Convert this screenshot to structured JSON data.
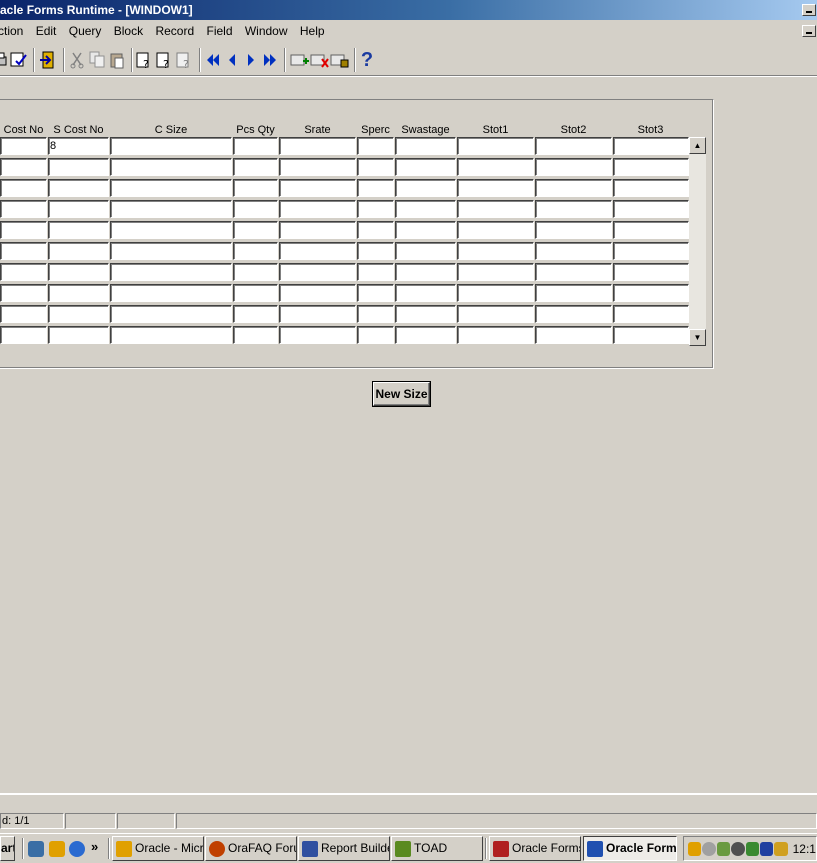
{
  "window": {
    "title": "acle Forms Runtime - [WINDOW1]"
  },
  "menu": [
    "ction",
    "Edit",
    "Query",
    "Block",
    "Record",
    "Field",
    "Window",
    "Help"
  ],
  "toolbar": {
    "help_glyph": "?",
    "icons": [
      "print-icon",
      "save-icon",
      "exit-icon",
      "cut-icon",
      "copy-icon",
      "paste-icon",
      "enter-query-icon",
      "execute-query-icon",
      "cancel-query-icon",
      "first-record-icon",
      "previous-record-icon",
      "next-record-icon",
      "last-record-icon",
      "insert-record-icon",
      "delete-record-icon",
      "lock-record-icon",
      "help-icon"
    ]
  },
  "grid": {
    "columns": [
      "Cost No",
      "S Cost No",
      "C Size",
      "Pcs Qty",
      "Srate",
      "Sperc",
      "Swastage",
      "Stot1",
      "Stot2",
      "Stot3"
    ],
    "rows": [
      [
        "",
        "8",
        "",
        "",
        "",
        "",
        "",
        "",
        "",
        ""
      ],
      [
        "",
        "",
        "",
        "",
        "",
        "",
        "",
        "",
        "",
        ""
      ],
      [
        "",
        "",
        "",
        "",
        "",
        "",
        "",
        "",
        "",
        ""
      ],
      [
        "",
        "",
        "",
        "",
        "",
        "",
        "",
        "",
        "",
        ""
      ],
      [
        "",
        "",
        "",
        "",
        "",
        "",
        "",
        "",
        "",
        ""
      ],
      [
        "",
        "",
        "",
        "",
        "",
        "",
        "",
        "",
        "",
        ""
      ],
      [
        "",
        "",
        "",
        "",
        "",
        "",
        "",
        "",
        "",
        ""
      ],
      [
        "",
        "",
        "",
        "",
        "",
        "",
        "",
        "",
        "",
        ""
      ],
      [
        "",
        "",
        "",
        "",
        "",
        "",
        "",
        "",
        "",
        ""
      ],
      [
        "",
        "",
        "",
        "",
        "",
        "",
        "",
        "",
        "",
        ""
      ]
    ],
    "scroll_up": "▲",
    "scroll_down": "▼"
  },
  "buttons": {
    "new_size": "New Size"
  },
  "status": {
    "record": "d: 1/1"
  },
  "taskbar": {
    "start": "art",
    "more": "»",
    "tasks": [
      {
        "label": "Oracle - Micro...",
        "icon_color": "#e0a000"
      },
      {
        "label": "OraFAQ Foru...",
        "icon_color": "#c04000"
      },
      {
        "label": "Report Builder...",
        "icon_color": "#3050a0"
      },
      {
        "label": "TOAD",
        "icon_color": "#5a8a20"
      },
      {
        "label": "Oracle Forms ...",
        "icon_color": "#b02020"
      },
      {
        "label": "Oracle Form...",
        "icon_color": "#2050b0"
      }
    ],
    "clock": "12:1"
  }
}
